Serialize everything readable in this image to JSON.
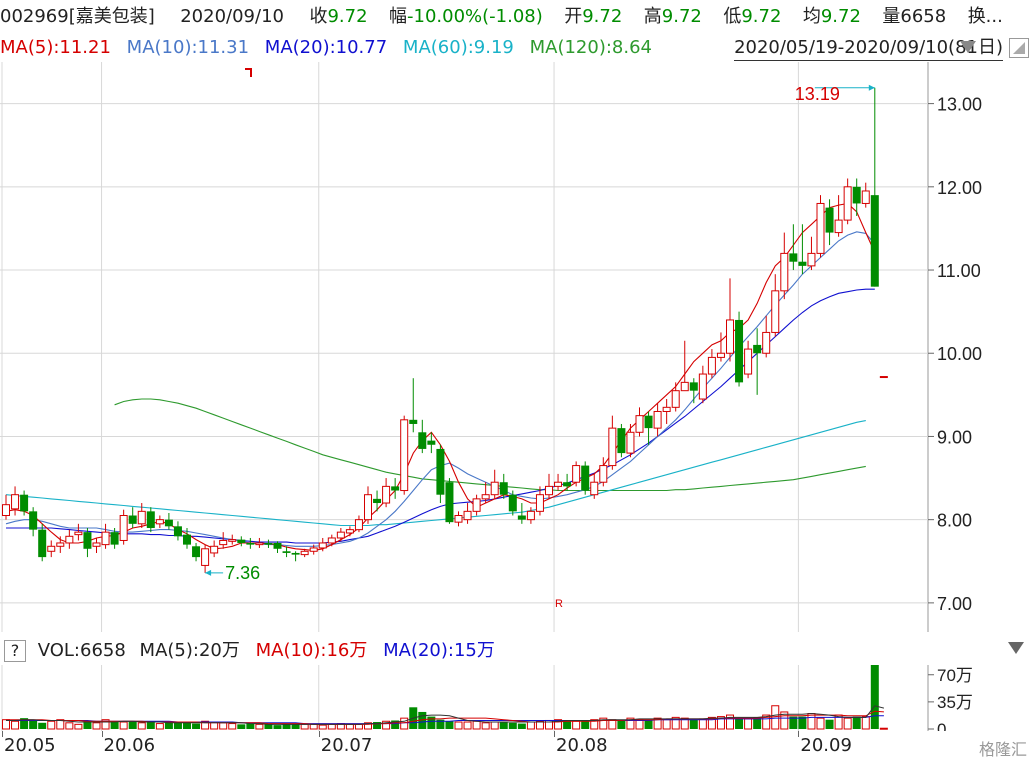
{
  "header": {
    "code": "002969[嘉美包装]",
    "date": "2020/09/10",
    "close_label": "收",
    "close": "9.72",
    "change_label": "幅",
    "change": "-10.00%(-1.08)",
    "open_label": "开",
    "open": "9.72",
    "high_label": "高",
    "high": "9.72",
    "low_label": "低",
    "low": "9.72",
    "avg_label": "均",
    "avg": "9.72",
    "vol_label": "量",
    "vol": "6658",
    "turnover_label": "换..."
  },
  "ma": {
    "ma5": "MA(5):11.21",
    "ma10": "MA(10):11.31",
    "ma20": "MA(20):10.77",
    "ma60": "MA(60):9.19",
    "ma120": "MA(120):8.64"
  },
  "date_range": "2020/05/19-2020/09/10(81日)",
  "volume_header": {
    "help": "?",
    "vol": "VOL:6658",
    "ma5": "MA(5):20万",
    "ma10": "MA(10):16万",
    "ma20": "MA(20):15万"
  },
  "logo": "格隆汇",
  "colors": {
    "up": "#d50000",
    "down": "#008c00",
    "ma5": "#d50000",
    "ma10": "#4a78c8",
    "ma20": "#1010d0",
    "ma60": "#19b2c8",
    "ma120": "#2e9a2e",
    "grid": "#d8d8d8"
  },
  "chart_data": {
    "type": "candlestick",
    "y_ticks": [
      "13.00",
      "12.00",
      "11.00",
      "10.00",
      "9.00",
      "8.00",
      "7.00"
    ],
    "y_tick_values": [
      13,
      12,
      11,
      10,
      9,
      8,
      7
    ],
    "ylim": [
      6.65,
      13.5
    ],
    "x_ticks": [
      "20.05",
      "20.06",
      "20.07",
      "20.08",
      "20.09"
    ],
    "x_tick_index": [
      0,
      11,
      35,
      61,
      88
    ],
    "annotations": {
      "high": {
        "text": "13.19",
        "value": 13.19,
        "index": 96
      },
      "low": {
        "text": "7.36",
        "value": 7.36,
        "index": 22
      },
      "marker": "R"
    },
    "candles": [
      [
        8.05,
        8.18,
        8.3,
        8.0
      ],
      [
        8.13,
        8.3,
        8.4,
        8.05
      ],
      [
        8.3,
        8.1,
        8.35,
        8.05
      ],
      [
        8.1,
        7.88,
        8.15,
        7.8
      ],
      [
        7.88,
        7.55,
        7.95,
        7.5
      ],
      [
        7.62,
        7.68,
        7.75,
        7.55
      ],
      [
        7.68,
        7.72,
        7.8,
        7.6
      ],
      [
        7.72,
        7.8,
        7.88,
        7.65
      ],
      [
        7.82,
        7.85,
        7.95,
        7.75
      ],
      [
        7.85,
        7.65,
        7.9,
        7.55
      ],
      [
        7.68,
        7.72,
        7.78,
        7.6
      ],
      [
        7.7,
        7.85,
        7.95,
        7.65
      ],
      [
        7.85,
        7.7,
        7.9,
        7.65
      ],
      [
        7.75,
        8.05,
        8.12,
        7.7
      ],
      [
        8.05,
        7.95,
        8.15,
        7.9
      ],
      [
        7.95,
        8.1,
        8.2,
        7.9
      ],
      [
        8.1,
        7.9,
        8.15,
        7.85
      ],
      [
        7.95,
        8.0,
        8.05,
        7.9
      ],
      [
        8.0,
        7.92,
        8.08,
        7.88
      ],
      [
        7.92,
        7.8,
        7.98,
        7.75
      ],
      [
        7.82,
        7.7,
        7.9,
        7.65
      ],
      [
        7.68,
        7.55,
        7.72,
        7.5
      ],
      [
        7.45,
        7.65,
        7.7,
        7.36
      ],
      [
        7.6,
        7.68,
        7.75,
        7.55
      ],
      [
        7.7,
        7.75,
        7.85,
        7.65
      ],
      [
        7.74,
        7.76,
        7.82,
        7.7
      ],
      [
        7.76,
        7.72,
        7.8,
        7.68
      ],
      [
        7.72,
        7.7,
        7.78,
        7.65
      ],
      [
        7.7,
        7.72,
        7.78,
        7.66
      ],
      [
        7.72,
        7.7,
        7.76,
        7.66
      ],
      [
        7.72,
        7.65,
        7.74,
        7.6
      ],
      [
        7.62,
        7.6,
        7.68,
        7.55
      ],
      [
        7.6,
        7.58,
        7.62,
        7.5
      ],
      [
        7.58,
        7.62,
        7.65,
        7.55
      ],
      [
        7.62,
        7.66,
        7.7,
        7.58
      ],
      [
        7.66,
        7.72,
        7.78,
        7.62
      ],
      [
        7.72,
        7.78,
        7.82,
        7.68
      ],
      [
        7.78,
        7.85,
        7.9,
        7.74
      ],
      [
        7.84,
        7.88,
        7.92,
        7.8
      ],
      [
        7.88,
        8.0,
        8.05,
        7.85
      ],
      [
        8.0,
        8.3,
        8.4,
        7.95
      ],
      [
        8.25,
        8.2,
        8.35,
        8.1
      ],
      [
        8.2,
        8.4,
        8.5,
        8.15
      ],
      [
        8.4,
        8.35,
        8.5,
        8.25
      ],
      [
        8.35,
        9.2,
        9.25,
        8.3
      ],
      [
        9.2,
        9.15,
        9.7,
        9.05
      ],
      [
        9.05,
        8.85,
        9.2,
        8.8
      ],
      [
        8.95,
        8.9,
        9.05,
        8.8
      ],
      [
        8.85,
        8.3,
        8.9,
        8.2
      ],
      [
        8.45,
        7.97,
        8.5,
        7.95
      ],
      [
        7.97,
        8.05,
        8.1,
        7.92
      ],
      [
        8.0,
        8.1,
        8.2,
        7.95
      ],
      [
        8.1,
        8.25,
        8.3,
        8.05
      ],
      [
        8.25,
        8.3,
        8.45,
        8.2
      ],
      [
        8.3,
        8.45,
        8.6,
        8.25
      ],
      [
        8.45,
        8.3,
        8.55,
        8.25
      ],
      [
        8.3,
        8.1,
        8.35,
        8.05
      ],
      [
        8.05,
        8.0,
        8.2,
        7.95
      ],
      [
        8.0,
        8.1,
        8.15,
        7.95
      ],
      [
        8.1,
        8.3,
        8.4,
        8.05
      ],
      [
        8.3,
        8.4,
        8.55,
        8.25
      ],
      [
        8.4,
        8.45,
        8.55,
        8.35
      ],
      [
        8.45,
        8.4,
        8.55,
        8.35
      ],
      [
        8.45,
        8.65,
        8.7,
        8.4
      ],
      [
        8.65,
        8.35,
        8.7,
        8.3
      ],
      [
        8.3,
        8.45,
        8.55,
        8.25
      ],
      [
        8.45,
        8.65,
        8.75,
        8.4
      ],
      [
        8.65,
        9.1,
        9.25,
        8.6
      ],
      [
        9.1,
        8.8,
        9.15,
        8.75
      ],
      [
        8.8,
        9.05,
        9.15,
        8.75
      ],
      [
        9.05,
        9.25,
        9.35,
        9.0
      ],
      [
        9.25,
        9.1,
        9.3,
        8.9
      ],
      [
        9.1,
        9.3,
        9.4,
        9.0
      ],
      [
        9.3,
        9.35,
        9.45,
        9.15
      ],
      [
        9.35,
        9.55,
        9.65,
        9.3
      ],
      [
        9.55,
        9.65,
        10.15,
        9.55
      ],
      [
        9.65,
        9.55,
        9.7,
        9.4
      ],
      [
        9.45,
        9.75,
        9.85,
        9.4
      ],
      [
        9.75,
        9.95,
        10.05,
        9.7
      ],
      [
        9.95,
        10.0,
        10.25,
        9.9
      ],
      [
        10.0,
        10.4,
        10.9,
        9.9
      ],
      [
        10.4,
        9.65,
        10.5,
        9.6
      ],
      [
        9.75,
        10.05,
        10.15,
        9.7
      ],
      [
        10.1,
        10.0,
        10.3,
        9.5
      ],
      [
        10.0,
        10.25,
        10.45,
        9.95
      ],
      [
        10.25,
        10.75,
        10.95,
        10.2
      ],
      [
        10.75,
        11.2,
        11.45,
        10.65
      ],
      [
        11.2,
        11.1,
        11.55,
        11.0
      ],
      [
        11.1,
        11.05,
        11.55,
        10.95
      ],
      [
        11.05,
        11.2,
        11.4,
        11.0
      ],
      [
        11.2,
        11.8,
        11.9,
        11.15
      ],
      [
        11.75,
        11.45,
        11.85,
        11.3
      ],
      [
        11.45,
        11.6,
        11.9,
        11.4
      ],
      [
        11.6,
        12.0,
        12.1,
        11.55
      ],
      [
        12.0,
        11.8,
        12.1,
        11.65
      ],
      [
        11.8,
        11.95,
        12.05,
        11.75
      ],
      [
        11.9,
        10.8,
        13.19,
        10.8
      ],
      [
        9.72,
        9.72,
        9.72,
        9.72
      ]
    ],
    "ma5": [
      8.1,
      8.12,
      8.1,
      8.05,
      7.95,
      7.85,
      7.76,
      7.72,
      7.72,
      7.74,
      7.78,
      7.8,
      7.81,
      7.85,
      7.9,
      7.92,
      7.95,
      7.98,
      7.95,
      7.88,
      7.83,
      7.76,
      7.7,
      7.65,
      7.66,
      7.68,
      7.72,
      7.72,
      7.72,
      7.71,
      7.7,
      7.67,
      7.65,
      7.64,
      7.63,
      7.65,
      7.7,
      7.76,
      7.82,
      7.9,
      8.02,
      8.12,
      8.24,
      8.35,
      8.55,
      8.8,
      8.95,
      9.05,
      8.9,
      8.7,
      8.45,
      8.25,
      8.15,
      8.2,
      8.25,
      8.3,
      8.28,
      8.25,
      8.2,
      8.2,
      8.25,
      8.3,
      8.38,
      8.45,
      8.5,
      8.55,
      8.65,
      8.8,
      8.95,
      9.1,
      9.2,
      9.3,
      9.4,
      9.5,
      9.6,
      9.75,
      9.9,
      10.0,
      10.1,
      10.15,
      10.25,
      10.3,
      10.4,
      10.6,
      10.85,
      11.05,
      11.15,
      11.3,
      11.45,
      11.55,
      11.65,
      11.75,
      11.78,
      11.8,
      11.7,
      11.45,
      11.21
    ],
    "ma10": [
      7.95,
      7.98,
      8.0,
      8.0,
      7.98,
      7.95,
      7.92,
      7.9,
      7.9,
      7.9,
      7.9,
      7.88,
      7.86,
      7.85,
      7.85,
      7.86,
      7.87,
      7.88,
      7.88,
      7.87,
      7.86,
      7.84,
      7.82,
      7.8,
      7.78,
      7.76,
      7.74,
      7.72,
      7.71,
      7.7,
      7.7,
      7.69,
      7.68,
      7.68,
      7.68,
      7.69,
      7.7,
      7.72,
      7.74,
      7.78,
      7.84,
      7.92,
      8.0,
      8.1,
      8.22,
      8.35,
      8.48,
      8.6,
      8.65,
      8.68,
      8.62,
      8.55,
      8.5,
      8.45,
      8.4,
      8.35,
      8.3,
      8.28,
      8.26,
      8.25,
      8.26,
      8.28,
      8.3,
      8.33,
      8.36,
      8.4,
      8.46,
      8.54,
      8.62,
      8.7,
      8.8,
      8.9,
      9.0,
      9.1,
      9.2,
      9.32,
      9.45,
      9.58,
      9.7,
      9.82,
      9.95,
      10.08,
      10.2,
      10.32,
      10.45,
      10.58,
      10.7,
      10.82,
      10.95,
      11.05,
      11.15,
      11.25,
      11.35,
      11.42,
      11.46,
      11.44,
      11.31
    ],
    "ma20": [
      7.9,
      7.9,
      7.9,
      7.9,
      7.9,
      7.9,
      7.89,
      7.88,
      7.87,
      7.86,
      7.85,
      7.84,
      7.84,
      7.83,
      7.83,
      7.83,
      7.82,
      7.82,
      7.81,
      7.81,
      7.8,
      7.8,
      7.79,
      7.78,
      7.77,
      7.76,
      7.75,
      7.74,
      7.73,
      7.73,
      7.73,
      7.73,
      7.72,
      7.72,
      7.72,
      7.72,
      7.73,
      7.74,
      7.76,
      7.78,
      7.8,
      7.84,
      7.88,
      7.92,
      7.97,
      8.02,
      8.07,
      8.12,
      8.16,
      8.19,
      8.2,
      8.21,
      8.22,
      8.23,
      8.25,
      8.27,
      8.29,
      8.31,
      8.33,
      8.35,
      8.38,
      8.41,
      8.44,
      8.48,
      8.52,
      8.56,
      8.61,
      8.66,
      8.72,
      8.78,
      8.85,
      8.92,
      9.0,
      9.08,
      9.16,
      9.24,
      9.33,
      9.42,
      9.51,
      9.6,
      9.7,
      9.8,
      9.9,
      10.0,
      10.1,
      10.2,
      10.3,
      10.4,
      10.49,
      10.57,
      10.63,
      10.68,
      10.72,
      10.74,
      10.76,
      10.77,
      10.77
    ],
    "ma60": [
      8.3,
      8.29,
      8.28,
      8.27,
      8.26,
      8.25,
      8.24,
      8.23,
      8.22,
      8.21,
      8.2,
      8.19,
      8.18,
      8.17,
      8.16,
      8.15,
      8.14,
      8.13,
      8.12,
      8.11,
      8.1,
      8.09,
      8.08,
      8.07,
      8.06,
      8.05,
      8.04,
      8.03,
      8.02,
      8.01,
      8.0,
      7.99,
      7.98,
      7.97,
      7.96,
      7.95,
      7.94,
      7.93,
      7.93,
      7.93,
      7.93,
      7.94,
      7.94,
      7.95,
      7.96,
      7.97,
      7.98,
      7.99,
      8.0,
      8.01,
      8.02,
      8.03,
      8.04,
      8.05,
      8.06,
      8.07,
      8.08,
      8.09,
      8.11,
      8.13,
      8.15,
      8.18,
      8.21,
      8.24,
      8.27,
      8.3,
      8.33,
      8.36,
      8.39,
      8.42,
      8.45,
      8.48,
      8.51,
      8.54,
      8.57,
      8.6,
      8.63,
      8.66,
      8.69,
      8.72,
      8.75,
      8.78,
      8.81,
      8.84,
      8.87,
      8.9,
      8.93,
      8.96,
      8.99,
      9.02,
      9.05,
      9.08,
      9.11,
      9.14,
      9.17,
      9.19
    ],
    "ma120_start": 12,
    "ma120": [
      9.38,
      9.42,
      9.44,
      9.45,
      9.45,
      9.44,
      9.42,
      9.4,
      9.37,
      9.34,
      9.3,
      9.26,
      9.22,
      9.18,
      9.14,
      9.1,
      9.06,
      9.02,
      8.98,
      8.94,
      8.9,
      8.86,
      8.82,
      8.78,
      8.75,
      8.72,
      8.69,
      8.66,
      8.63,
      8.6,
      8.57,
      8.55,
      8.53,
      8.51,
      8.49,
      8.48,
      8.47,
      8.46,
      8.45,
      8.44,
      8.43,
      8.42,
      8.41,
      8.4,
      8.39,
      8.38,
      8.37,
      8.36,
      8.36,
      8.35,
      8.35,
      8.35,
      8.35,
      8.35,
      8.35,
      8.35,
      8.35,
      8.35,
      8.35,
      8.35,
      8.35,
      8.35,
      8.36,
      8.36,
      8.37,
      8.38,
      8.39,
      8.4,
      8.41,
      8.42,
      8.43,
      8.44,
      8.45,
      8.46,
      8.47,
      8.48,
      8.5,
      8.52,
      8.54,
      8.56,
      8.58,
      8.6,
      8.62,
      8.64
    ],
    "volume": {
      "y_ticks": [
        "70万",
        "35万",
        "0"
      ],
      "y_tick_values": [
        70,
        35,
        0
      ],
      "ylim": [
        0,
        80
      ],
      "unit": "万",
      "values": [
        12,
        10,
        14,
        12,
        8,
        10,
        12,
        8,
        6,
        10,
        8,
        12,
        10,
        9,
        10,
        8,
        9,
        7,
        8,
        9,
        8,
        7,
        10,
        9,
        8,
        7,
        6,
        7,
        6,
        6,
        5,
        6,
        7,
        6,
        6,
        5,
        6,
        7,
        6,
        6,
        8,
        9,
        10,
        11,
        14,
        28,
        22,
        16,
        12,
        10,
        9,
        9,
        10,
        8,
        9,
        9,
        8,
        7,
        9,
        10,
        11,
        12,
        10,
        10,
        11,
        12,
        14,
        12,
        12,
        14,
        12,
        12,
        14,
        12,
        15,
        14,
        12,
        13,
        15,
        16,
        18,
        14,
        13,
        15,
        18,
        30,
        22,
        16,
        16,
        20,
        14,
        12,
        18,
        14,
        16,
        16,
        85,
        1
      ],
      "ma5": [
        11,
        11,
        12,
        12,
        11,
        11,
        11,
        10,
        9,
        9,
        9,
        9,
        9,
        10,
        10,
        9,
        9,
        9,
        8,
        8,
        8,
        8,
        8,
        8,
        8,
        8,
        8,
        7,
        7,
        6,
        6,
        6,
        6,
        6,
        6,
        6,
        6,
        6,
        6,
        6,
        7,
        7,
        8,
        9,
        10,
        14,
        17,
        18,
        18,
        17,
        14,
        11,
        10,
        9,
        9,
        9,
        9,
        9,
        9,
        9,
        9,
        10,
        11,
        11,
        11,
        11,
        12,
        12,
        12,
        12,
        13,
        13,
        13,
        13,
        13,
        13,
        13,
        13,
        14,
        14,
        15,
        15,
        15,
        15,
        16,
        18,
        19,
        19,
        19,
        20,
        19,
        18,
        16,
        15,
        15,
        15,
        30,
        27
      ],
      "ma10": [
        12,
        12,
        12,
        12,
        12,
        11,
        11,
        11,
        11,
        10,
        10,
        10,
        10,
        10,
        10,
        10,
        9,
        9,
        9,
        9,
        9,
        9,
        8,
        8,
        8,
        8,
        8,
        8,
        8,
        7,
        7,
        7,
        7,
        7,
        6,
        6,
        6,
        6,
        6,
        6,
        6,
        7,
        7,
        8,
        8,
        10,
        12,
        13,
        13,
        14,
        14,
        14,
        14,
        14,
        13,
        12,
        11,
        10,
        9,
        9,
        9,
        9,
        10,
        10,
        10,
        10,
        11,
        11,
        11,
        12,
        12,
        12,
        12,
        13,
        13,
        13,
        13,
        13,
        13,
        14,
        14,
        14,
        14,
        14,
        15,
        16,
        17,
        17,
        17,
        18,
        18,
        18,
        18,
        17,
        17,
        17,
        23,
        22
      ],
      "ma20": [
        11,
        11,
        11,
        11,
        11,
        11,
        11,
        11,
        11,
        11,
        10,
        10,
        10,
        10,
        10,
        10,
        10,
        10,
        10,
        9,
        9,
        9,
        9,
        9,
        9,
        9,
        8,
        8,
        8,
        8,
        8,
        8,
        8,
        7,
        7,
        7,
        7,
        7,
        7,
        7,
        7,
        7,
        7,
        7,
        8,
        8,
        9,
        10,
        10,
        10,
        11,
        11,
        11,
        11,
        11,
        11,
        11,
        11,
        11,
        11,
        11,
        11,
        11,
        11,
        11,
        11,
        11,
        11,
        11,
        11,
        11,
        11,
        12,
        12,
        12,
        12,
        12,
        12,
        12,
        13,
        13,
        13,
        13,
        13,
        13,
        14,
        14,
        14,
        14,
        15,
        15,
        15,
        15,
        15,
        15,
        15,
        17,
        17
      ]
    }
  }
}
